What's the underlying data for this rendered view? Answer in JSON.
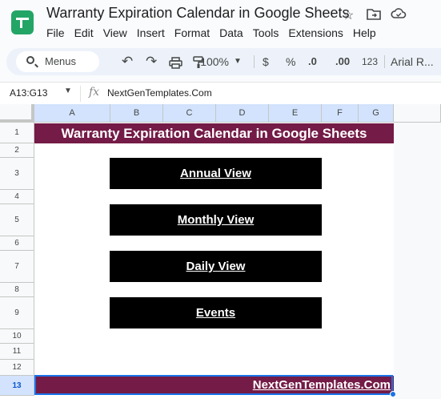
{
  "app": {
    "title": "Warranty Expiration Calendar in Google Sheets",
    "menu": [
      "File",
      "Edit",
      "View",
      "Insert",
      "Format",
      "Data",
      "Tools",
      "Extensions",
      "Help"
    ]
  },
  "toolbar": {
    "search_label": "Menus",
    "zoom": "100%",
    "currency": "$",
    "percent": "%",
    "dec_decrease": ".0",
    "dec_increase": ".00",
    "number_format": "123",
    "font": "Arial R..."
  },
  "formula_bar": {
    "name_box": "A13:G13",
    "fx": "fx",
    "formula": "NextGenTemplates.Com"
  },
  "sheet": {
    "columns": [
      "A",
      "B",
      "C",
      "D",
      "E",
      "F",
      "G"
    ],
    "rows": [
      "1",
      "2",
      "3",
      "4",
      "5",
      "6",
      "7",
      "8",
      "9",
      "10",
      "11",
      "12",
      "13"
    ],
    "title": "Warranty Expiration Calendar in Google Sheets",
    "buttons": {
      "annual": "Annual View",
      "monthly": "Monthly View",
      "daily": "Daily View",
      "events": "Events"
    },
    "footer": "NextGenTemplates.Com"
  }
}
